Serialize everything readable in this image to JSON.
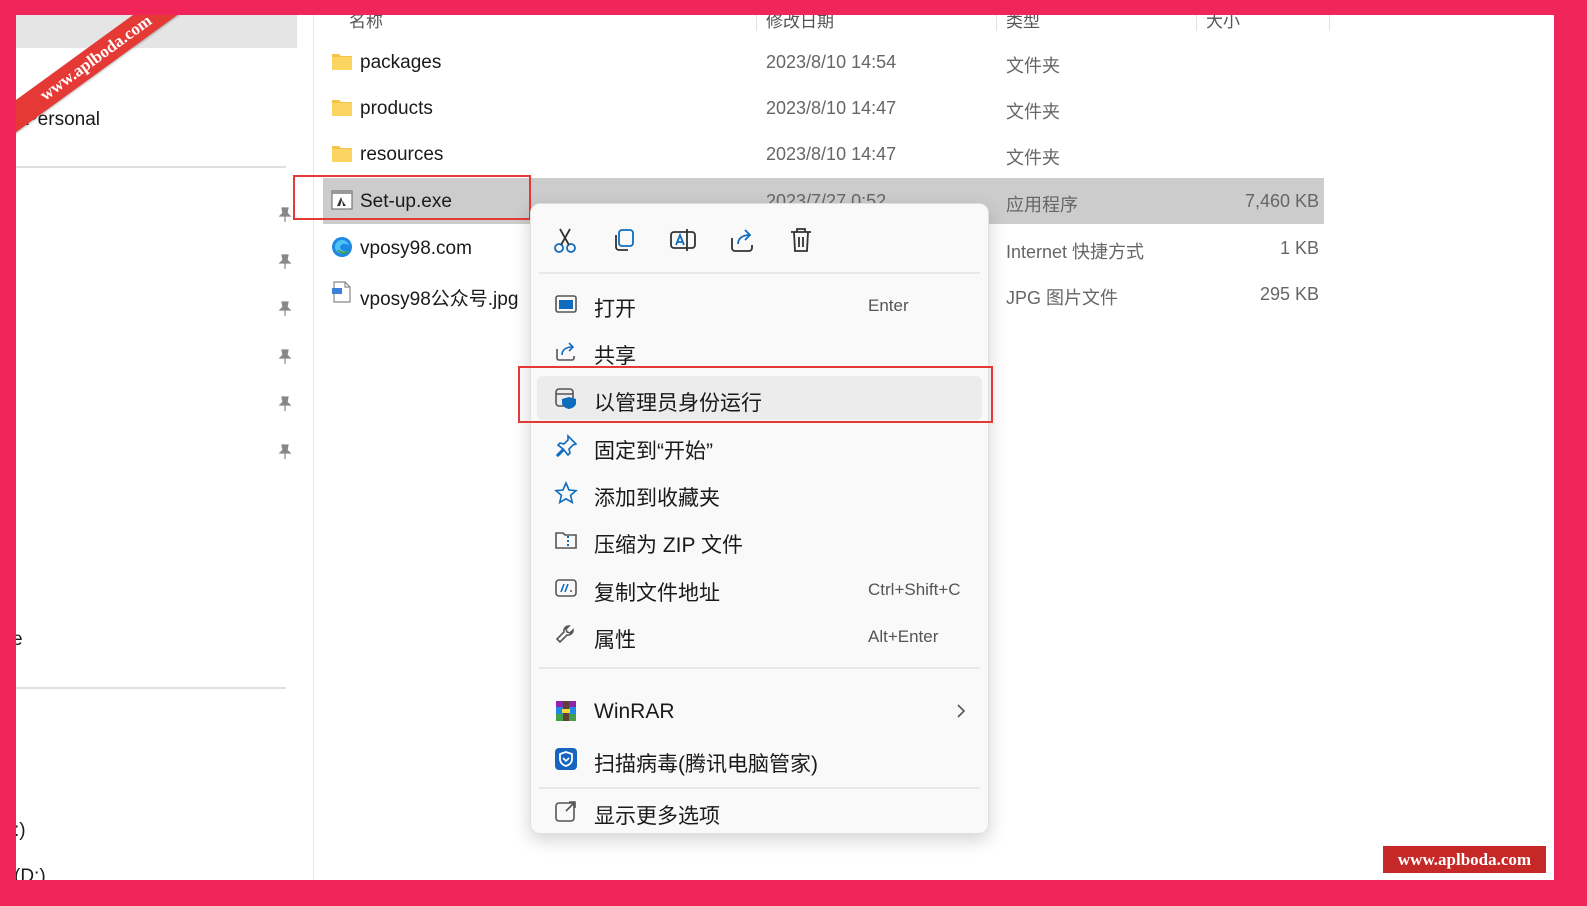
{
  "watermark": {
    "ribbon_text": "www.aplboda.com",
    "corner_text": "www.aplboda.com"
  },
  "nav": {
    "personal_label": "Personal",
    "partial_label_mid": "e",
    "partial_drive_1": ":)",
    "partial_drive_2": "(D:)"
  },
  "columns": {
    "name": "名称",
    "date": "修改日期",
    "type": "类型",
    "size": "大小"
  },
  "files": [
    {
      "name": "packages",
      "date": "2023/8/10 14:54",
      "type": "文件夹",
      "size": "",
      "icon": "folder-icon"
    },
    {
      "name": "products",
      "date": "2023/8/10 14:47",
      "type": "文件夹",
      "size": "",
      "icon": "folder-icon"
    },
    {
      "name": "resources",
      "date": "2023/8/10 14:47",
      "type": "文件夹",
      "size": "",
      "icon": "folder-icon"
    },
    {
      "name": "Set-up.exe",
      "date": "2023/7/27 0:52",
      "type": "应用程序",
      "size": "7,460 KB",
      "icon": "exe-icon"
    },
    {
      "name": "vposy98.com",
      "date": "",
      "type": "Internet 快捷方式",
      "size": "1 KB",
      "icon": "edge-icon"
    },
    {
      "name": "vposy98公众号.jpg",
      "date": "",
      "type": "JPG 图片文件",
      "size": "295 KB",
      "icon": "image-file-icon"
    }
  ],
  "context_menu": {
    "quick_actions": [
      "cut-icon",
      "copy-icon",
      "rename-icon",
      "share-icon",
      "delete-icon"
    ],
    "items": [
      {
        "label": "打开",
        "shortcut": "Enter",
        "icon": "open-icon"
      },
      {
        "label": "共享",
        "shortcut": "",
        "icon": "share-icon"
      },
      {
        "label": "以管理员身份运行",
        "shortcut": "",
        "icon": "run-as-admin-icon"
      },
      {
        "label": "固定到“开始”",
        "shortcut": "",
        "icon": "pin-icon"
      },
      {
        "label": "添加到收藏夹",
        "shortcut": "",
        "icon": "star-icon"
      },
      {
        "label": "压缩为 ZIP 文件",
        "shortcut": "",
        "icon": "zip-icon"
      },
      {
        "label": "复制文件地址",
        "shortcut": "Ctrl+Shift+C",
        "icon": "copy-path-icon"
      },
      {
        "label": "属性",
        "shortcut": "Alt+Enter",
        "icon": "wrench-icon"
      },
      {
        "label": "WinRAR",
        "shortcut": "",
        "icon": "winrar-icon"
      },
      {
        "label": "扫描病毒(腾讯电脑管家)",
        "shortcut": "",
        "icon": "tencent-shield-icon"
      },
      {
        "label": "显示更多选项",
        "shortcut": "",
        "icon": "more-options-icon"
      }
    ]
  },
  "colors": {
    "frame": "#f0265a",
    "highlight": "#e53935",
    "accent": "#0f6cbd",
    "folder": "#f5c34a"
  }
}
